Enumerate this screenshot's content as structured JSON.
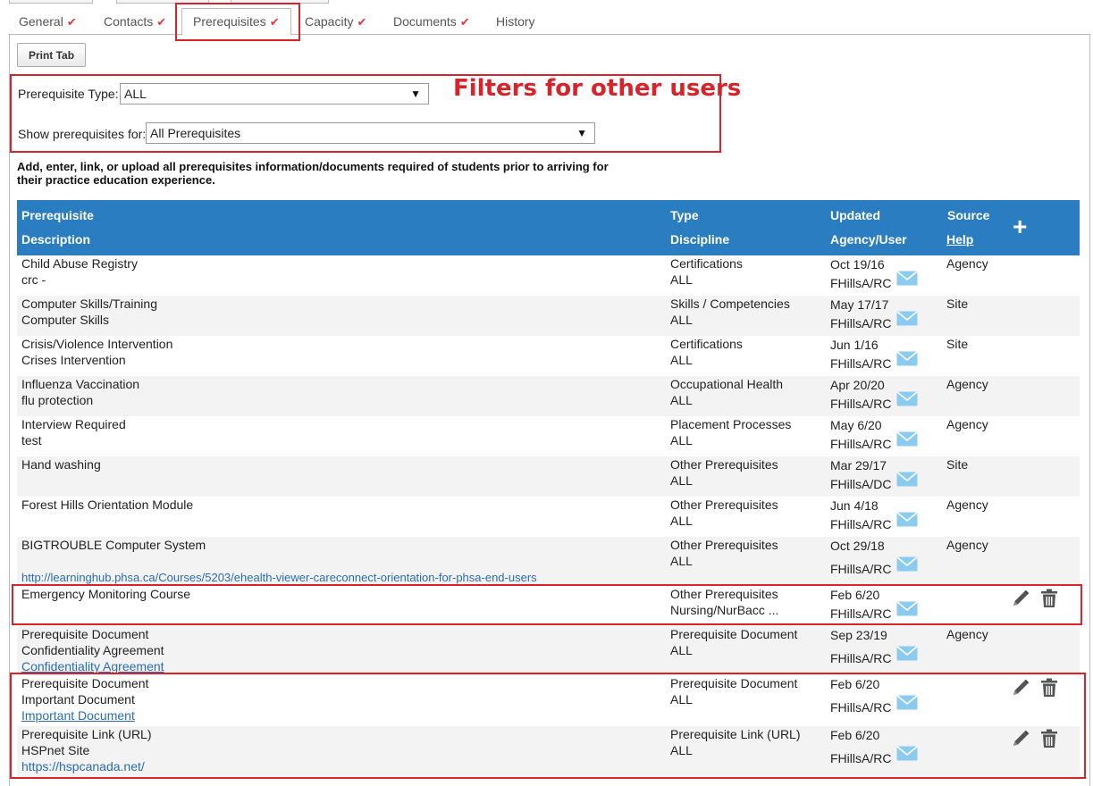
{
  "tabs": [
    {
      "label": "General",
      "checked": true
    },
    {
      "label": "Contacts",
      "checked": true
    },
    {
      "label": "Prerequisites",
      "checked": true
    },
    {
      "label": "Capacity",
      "checked": true
    },
    {
      "label": "Documents",
      "checked": true
    },
    {
      "label": "History",
      "checked": false
    }
  ],
  "active_tab": "Prerequisites",
  "print_button": "Print Tab",
  "filters": {
    "type_label": "Prerequisite Type:",
    "type_value": "ALL",
    "show_label": "Show prerequisites for:",
    "show_value": "All Prerequisites"
  },
  "annotation": "Filters for other users",
  "intro": "Add, enter, link, or upload all prerequisites information/documents required of students prior to arriving for their practice education experience.",
  "table": {
    "headers": {
      "prerequisite": "Prerequisite",
      "description": "Description",
      "type": "Type",
      "discipline": "Discipline",
      "updated": "Updated",
      "agency_user": "Agency/User",
      "source": "Source",
      "help": "Help"
    },
    "rows": [
      {
        "name": "Child Abuse Registry",
        "desc": "crc -",
        "link": "",
        "type": "Certifications",
        "discipline": "ALL",
        "updated": "Oct 19/16",
        "user": "FHillsA/RC",
        "source": "Agency",
        "actions": false
      },
      {
        "name": "Computer Skills/Training",
        "desc": "Computer Skills",
        "link": "",
        "type": "Skills / Competencies",
        "discipline": "ALL",
        "updated": "May 17/17",
        "user": "FHillsA/RC",
        "source": "Site",
        "actions": false
      },
      {
        "name": "Crisis/Violence Intervention",
        "desc": "Crises Intervention",
        "link": "",
        "type": "Certifications",
        "discipline": "ALL",
        "updated": "Jun 1/16",
        "user": "FHillsA/RC",
        "source": "Site",
        "actions": false
      },
      {
        "name": "Influenza Vaccination",
        "desc": "flu protection",
        "link": "",
        "type": "Occupational Health",
        "discipline": "ALL",
        "updated": "Apr 20/20",
        "user": "FHillsA/RC",
        "source": "Agency",
        "actions": false
      },
      {
        "name": "Interview Required",
        "desc": "test",
        "link": "",
        "type": "Placement Processes",
        "discipline": "ALL",
        "updated": "May 6/20",
        "user": "FHillsA/RC",
        "source": "Agency",
        "actions": false
      },
      {
        "name": "Hand washing",
        "desc": "",
        "link": "",
        "type": "Other Prerequisites",
        "discipline": "ALL",
        "updated": "Mar 29/17",
        "user": "FHillsA/DC",
        "source": "Site",
        "actions": false
      },
      {
        "name": "Forest Hills Orientation Module",
        "desc": "",
        "link": "",
        "type": "Other Prerequisites",
        "discipline": "ALL",
        "updated": "Jun 4/18",
        "user": "FHillsA/RC",
        "source": "Agency",
        "actions": false
      },
      {
        "name": "BIGTROUBLE Computer System",
        "desc": "",
        "link": "http://learninghub.phsa.ca/Courses/5203/ehealth-viewer-careconnect-orientation-for-phsa-end-users",
        "type": "Other Prerequisites",
        "discipline": "ALL",
        "updated": "Oct 29/18",
        "user": "FHillsA/RC",
        "source": "Agency",
        "actions": false
      },
      {
        "name": "Emergency Monitoring Course",
        "desc": "",
        "link": "",
        "type": "Other Prerequisites",
        "discipline": "Nursing/NurBacc ...",
        "updated": "Feb 6/20",
        "user": "FHillsA/RC",
        "source": "",
        "actions": true
      },
      {
        "name": "Prerequisite Document",
        "desc": "Confidentiality Agreement",
        "link": "Confidentiality Agreement",
        "type": "Prerequisite Document",
        "discipline": "ALL",
        "updated": "Sep 23/19",
        "user": "FHillsA/RC",
        "source": "Agency",
        "actions": false
      },
      {
        "name": "Prerequisite Document",
        "desc": "Important Document",
        "link": "Important Document",
        "type": "Prerequisite Document",
        "discipline": "ALL",
        "updated": "Feb 6/20",
        "user": "FHillsA/RC",
        "source": "",
        "actions": true
      },
      {
        "name": "Prerequisite Link (URL)",
        "desc": "HSPnet Site",
        "link": "https://hspcanada.net/",
        "type": "Prerequisite Link (URL)",
        "discipline": "ALL",
        "updated": "Feb 6/20",
        "user": "FHillsA/RC",
        "source": "",
        "actions": true
      }
    ]
  },
  "colors": {
    "header_bg": "#2b7dc1",
    "check": "#e23838",
    "annotation": "#d8232a",
    "link": "#2a6db0",
    "mail": "#8ccbf0"
  },
  "icons": {
    "check": "check-icon",
    "mail": "mail-icon",
    "edit": "pencil-icon",
    "delete": "trash-icon",
    "add": "plus-icon"
  }
}
